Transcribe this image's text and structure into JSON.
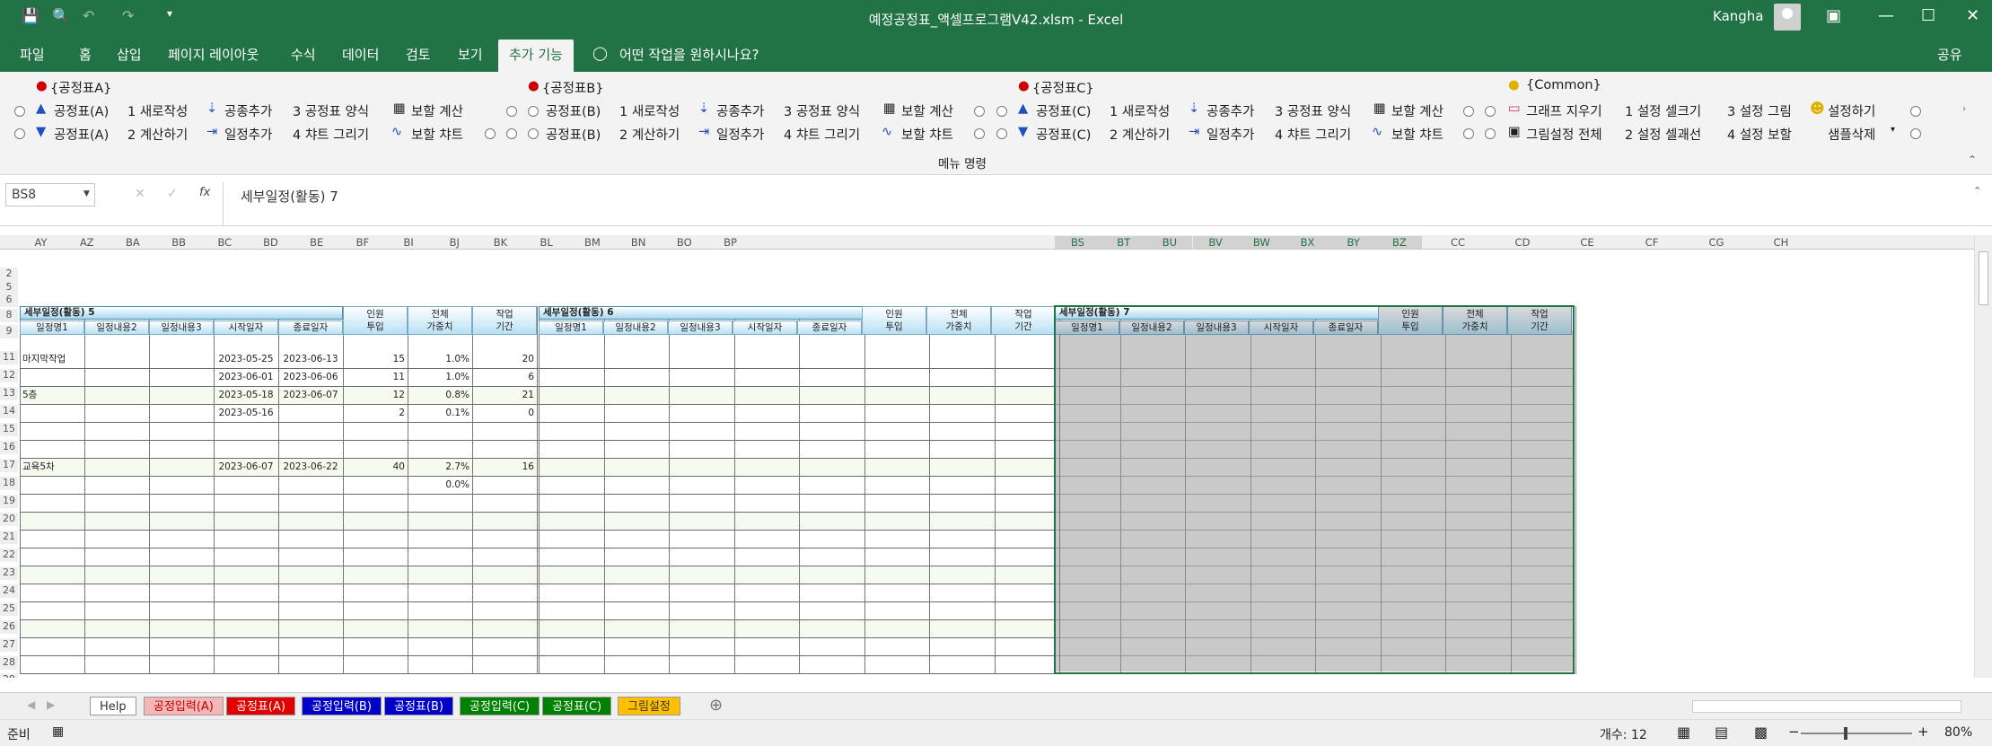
{
  "window": {
    "title": "예정공정표_액셀프로그램V42.xlsm  -  Excel",
    "user": "Kangha"
  },
  "tabs": [
    "파일",
    "홈",
    "삽입",
    "페이지 레이아웃",
    "수식",
    "데이터",
    "검토",
    "보기",
    "추가 기능"
  ],
  "tell_me": "어떤 작업을 원하시나요?",
  "share": "공유",
  "ribbon": {
    "group_label": "메뉴 명령",
    "groups": [
      {
        "title": "{공정표A}",
        "row1": [
          "공정표(A)",
          "1  새로작성",
          "공종추가",
          "3  공정표 양식",
          "보할 계산"
        ],
        "row2": [
          "공정표(A)",
          "2  계산하기",
          "일정추가",
          "4  챠트 그리기",
          "보할 챠트"
        ]
      },
      {
        "title": "{공정표B}",
        "row1": [
          "공정표(B)",
          "1  새로작성",
          "공종추가",
          "3  공정표 양식",
          "보할 계산"
        ],
        "row2": [
          "공정표(B)",
          "2  계산하기",
          "일정추가",
          "4  챠트 그리기",
          "보할 챠트"
        ]
      },
      {
        "title": "{공정표C}",
        "row1": [
          "공정표(C)",
          "1  새로작성",
          "공종추가",
          "3  공정표 양식",
          "보할 계산"
        ],
        "row2": [
          "공정표(C)",
          "2  계산하기",
          "일정추가",
          "4  챠트 그리기",
          "보할 챠트"
        ]
      },
      {
        "title": "{Common}",
        "row1": [
          "그래프 지우기",
          "1  설정 셀크기",
          "3  설정 그림",
          "설정하기"
        ],
        "row2": [
          "그림설정 전체",
          "2  설정 셀괘선",
          "4  설정 보할",
          "샘플삭제"
        ]
      }
    ]
  },
  "formula_bar": {
    "name_box": "BS8",
    "formula": "세부일정(활동) 7"
  },
  "columns": [
    "AY",
    "AZ",
    "BA",
    "BB",
    "BC",
    "BD",
    "BE",
    "BF",
    "BI",
    "BJ",
    "BK",
    "BL",
    "BM",
    "BN",
    "BO",
    "BP",
    "BS",
    "BT",
    "BU",
    "BV",
    "BW",
    "BX",
    "BY",
    "BZ",
    "CC",
    "CD",
    "CE",
    "CF",
    "CG",
    "CH"
  ],
  "sections": [
    {
      "title": "세부일정(활동) 5",
      "headers": [
        "일정명1",
        "일정내용2",
        "일정내용3",
        "시작일자",
        "종료일자",
        "인원\n투입",
        "전체\n가중치",
        "작업\n기간"
      ]
    },
    {
      "title": "세부일정(활동) 6",
      "headers": [
        "일정명1",
        "일정내용2",
        "일정내용3",
        "시작일자",
        "종료일자",
        "인원\n투입",
        "전체\n가중치",
        "작업\n기간"
      ]
    },
    {
      "title": "세부일정(활동) 7",
      "headers": [
        "일정명1",
        "일정내용2",
        "일정내용3",
        "시작일자",
        "종료일자",
        "인원\n투입",
        "전체\n가중치",
        "작업\n기간"
      ]
    }
  ],
  "row_numbers": [
    "2",
    "5",
    "6",
    "8",
    "9",
    "11",
    "12",
    "13",
    "14",
    "15",
    "16",
    "17",
    "18",
    "19",
    "20",
    "21",
    "22",
    "23",
    "24",
    "25",
    "26",
    "27",
    "28",
    "29"
  ],
  "data_rows": [
    {
      "row": "11",
      "cells": [
        "마지막작업",
        "",
        "",
        "2023-05-25",
        "2023-06-13",
        "15",
        "1.0%",
        "20"
      ]
    },
    {
      "row": "12",
      "cells": [
        "",
        "",
        "",
        "2023-06-01",
        "2023-06-06",
        "11",
        "1.0%",
        "6"
      ]
    },
    {
      "row": "13",
      "cells": [
        "5층",
        "",
        "",
        "2023-05-18",
        "2023-06-07",
        "12",
        "0.8%",
        "21"
      ]
    },
    {
      "row": "14",
      "cells": [
        "",
        "",
        "",
        "2023-05-16",
        "",
        "2",
        "0.1%",
        "0"
      ]
    },
    {
      "row": "17",
      "cells": [
        "교육5차",
        "",
        "",
        "2023-06-07",
        "2023-06-22",
        "40",
        "2.7%",
        "16"
      ]
    },
    {
      "row": "18",
      "cells": [
        "",
        "",
        "",
        "",
        "",
        "",
        "0.0%",
        ""
      ]
    }
  ],
  "sheet_tabs": [
    {
      "label": "Help",
      "color": "#ffffff",
      "text": "#333333"
    },
    {
      "label": "공정입력(A)",
      "color": "#f4b6b6",
      "text": "#c00000"
    },
    {
      "label": "공정표(A)",
      "color": "#e00000",
      "text": "#ffffff"
    },
    {
      "label": "공정입력(B)",
      "color": "#0000c8",
      "text": "#ffffff"
    },
    {
      "label": "공정표(B)",
      "color": "#0000c8",
      "text": "#ffffff"
    },
    {
      "label": "공정입력(C)",
      "color": "#008000",
      "text": "#ffffff"
    },
    {
      "label": "공정표(C)",
      "color": "#008000",
      "text": "#ffffff"
    },
    {
      "label": "그림설정",
      "color": "#ffc000",
      "text": "#333333"
    }
  ],
  "status": {
    "ready": "준비",
    "count": "개수: 12",
    "zoom": "80%"
  }
}
